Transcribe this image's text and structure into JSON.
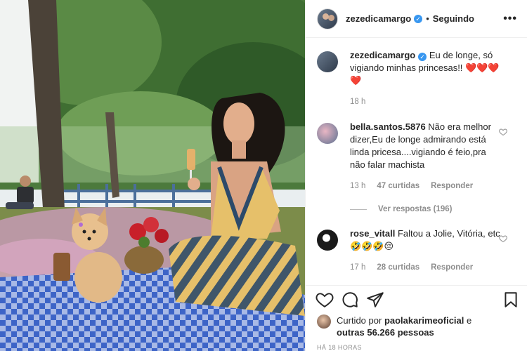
{
  "post": {
    "username": "zezedicamargo",
    "separator": "•",
    "follow_status": "Seguindo",
    "more_label": "•••"
  },
  "caption": {
    "username": "zezedicamargo",
    "text": "Eu de longe, só vigiando minhas princesas!!",
    "emoji": "❤️❤️❤️❤️",
    "time": "18 h"
  },
  "comments": [
    {
      "username": "bella.santos.5876",
      "text": "Não era melhor dizer,Eu de longe admirando está linda pricesa....vigiando é feio,pra não falar machista",
      "time": "13 h",
      "likes": "47 curtidas",
      "reply": "Responder"
    },
    {
      "username": "rose_vitall",
      "text": "Faltou a Jolie, Vitória, etc",
      "emoji": "🤣🤣🤣😔",
      "time": "17 h",
      "likes": "28 curtidas",
      "reply": "Responder"
    }
  ],
  "view_replies": "Ver respostas (196)",
  "likes": {
    "prefix": "Curtido por",
    "user": "paolakarimeoficial",
    "middle": "e",
    "others": "outras 56.266 pessoas"
  },
  "timestamp": "HÁ 18 HORAS",
  "colors": {
    "verified": "#3897f0",
    "secondary_text": "#8e8e8e",
    "heart_red": "#ed4956"
  },
  "icons": [
    "heart-icon",
    "comment-icon",
    "share-icon",
    "bookmark-icon",
    "verified-badge-icon",
    "more-options-icon"
  ]
}
